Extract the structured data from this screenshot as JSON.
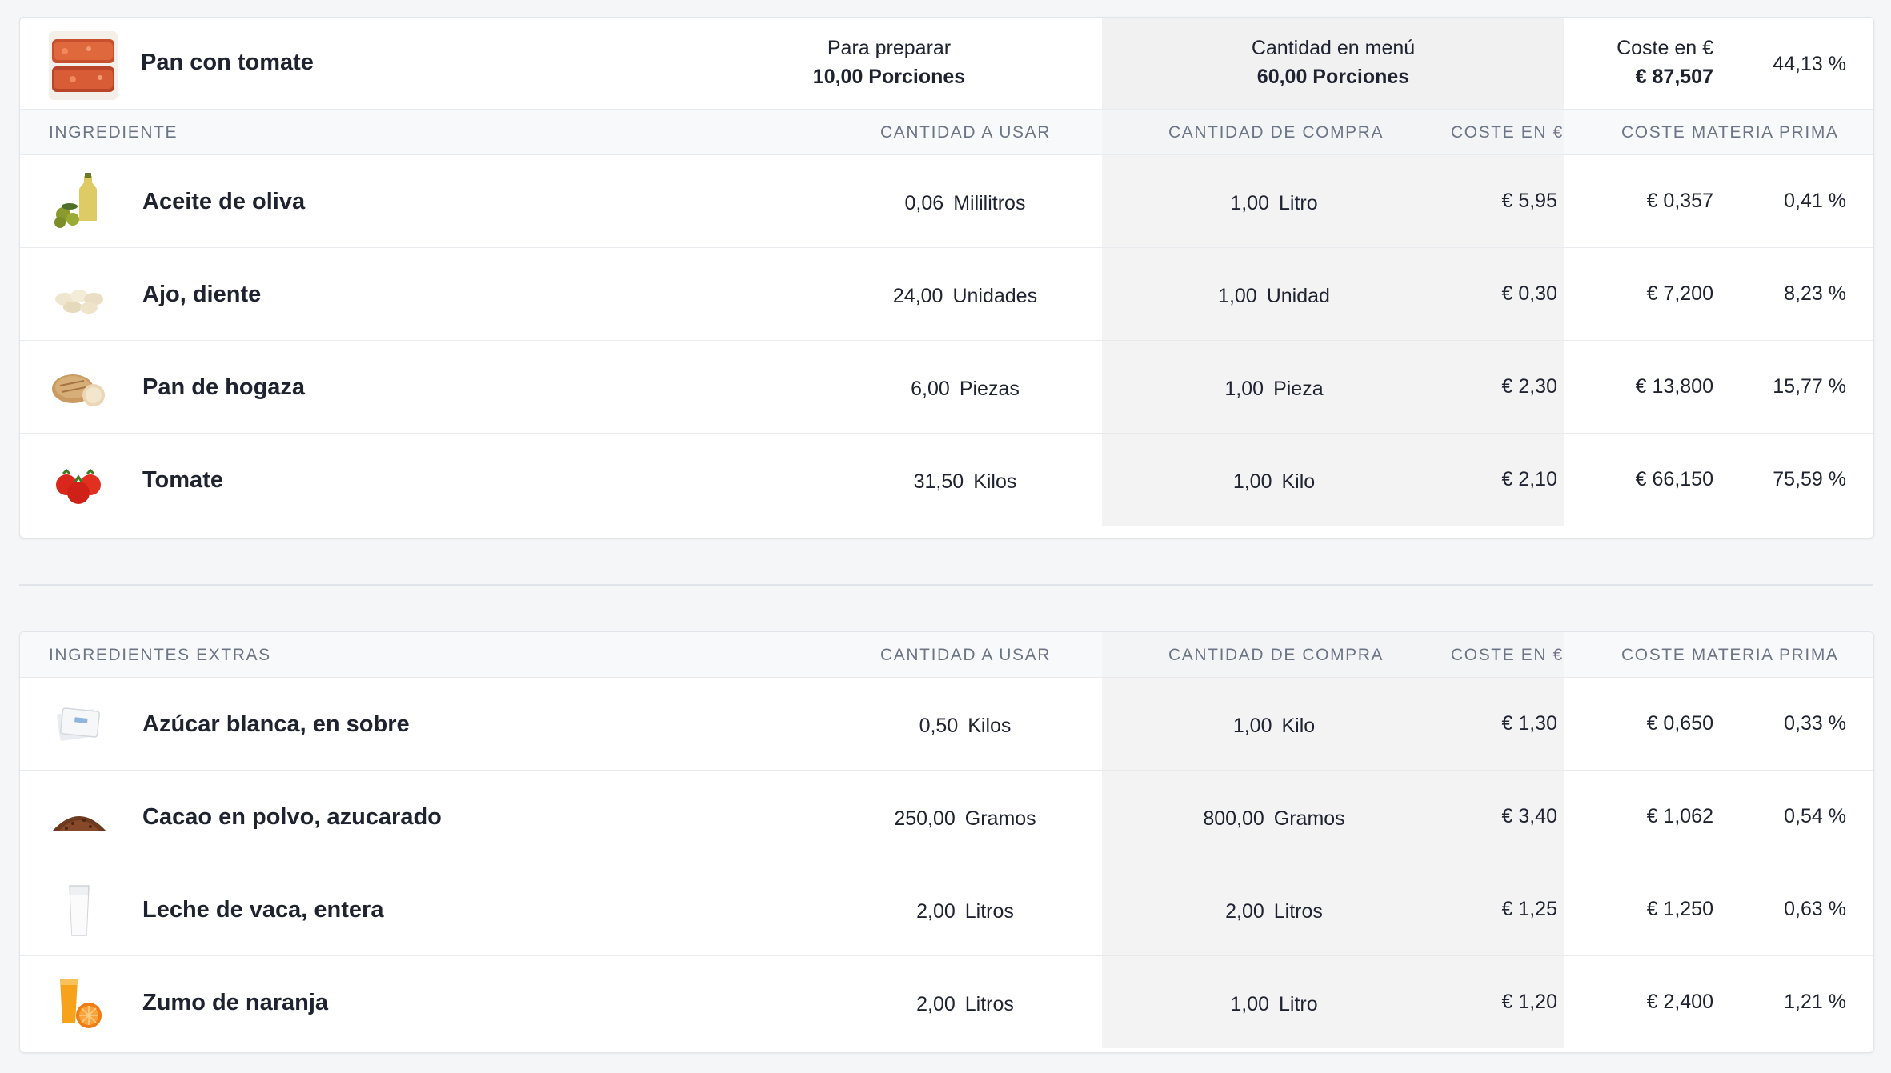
{
  "recipe": {
    "name": "Pan con tomate",
    "prepare_label": "Para preparar",
    "prepare_value": "10,00 Porciones",
    "menu_label": "Cantidad en menú",
    "menu_value": "60,00 Porciones",
    "cost_label": "Coste en €",
    "cost_value": "€ 87,507",
    "percent": "44,13 %",
    "thumb_icon": "bread-with-tomato-thumbnail"
  },
  "columns": {
    "qty_use": "CANTIDAD A USAR",
    "qty_buy": "CANTIDAD DE COMPRA",
    "cost": "COSTE EN €",
    "raw_cost": "COSTE MATERIA PRIMA"
  },
  "ingredients": {
    "title": "INGREDIENTE",
    "items": [
      {
        "name": "Aceite de oliva",
        "use_qty": "0,06",
        "use_unit": "Mililitros",
        "buy_qty": "1,00",
        "buy_unit": "Litro",
        "cost": "€ 5,95",
        "raw": "€ 0,357",
        "pct": "0,41 %",
        "icon": "olive-oil-thumbnail"
      },
      {
        "name": "Ajo, diente",
        "use_qty": "24,00",
        "use_unit": "Unidades",
        "buy_qty": "1,00",
        "buy_unit": "Unidad",
        "cost": "€ 0,30",
        "raw": "€ 7,200",
        "pct": "8,23 %",
        "icon": "garlic-thumbnail"
      },
      {
        "name": "Pan de hogaza",
        "use_qty": "6,00",
        "use_unit": "Piezas",
        "buy_qty": "1,00",
        "buy_unit": "Pieza",
        "cost": "€ 2,30",
        "raw": "€ 13,800",
        "pct": "15,77 %",
        "icon": "bread-loaf-thumbnail"
      },
      {
        "name": "Tomate",
        "use_qty": "31,50",
        "use_unit": "Kilos",
        "buy_qty": "1,00",
        "buy_unit": "Kilo",
        "cost": "€ 2,10",
        "raw": "€ 66,150",
        "pct": "75,59 %",
        "icon": "tomato-thumbnail"
      }
    ]
  },
  "extras": {
    "title": "INGREDIENTES EXTRAS",
    "items": [
      {
        "name": "Azúcar blanca, en sobre",
        "use_qty": "0,50",
        "use_unit": "Kilos",
        "buy_qty": "1,00",
        "buy_unit": "Kilo",
        "cost": "€ 1,30",
        "raw": "€ 0,650",
        "pct": "0,33 %",
        "icon": "sugar-sachet-thumbnail"
      },
      {
        "name": "Cacao en polvo, azucarado",
        "use_qty": "250,00",
        "use_unit": "Gramos",
        "buy_qty": "800,00",
        "buy_unit": "Gramos",
        "cost": "€ 3,40",
        "raw": "€ 1,062",
        "pct": "0,54 %",
        "icon": "cocoa-powder-thumbnail"
      },
      {
        "name": "Leche de vaca, entera",
        "use_qty": "2,00",
        "use_unit": "Litros",
        "buy_qty": "2,00",
        "buy_unit": "Litros",
        "cost": "€ 1,25",
        "raw": "€ 1,250",
        "pct": "0,63 %",
        "icon": "milk-glass-thumbnail"
      },
      {
        "name": "Zumo de naranja",
        "use_qty": "2,00",
        "use_unit": "Litros",
        "buy_qty": "1,00",
        "buy_unit": "Litro",
        "cost": "€ 1,20",
        "raw": "€ 2,400",
        "pct": "1,21 %",
        "icon": "orange-juice-thumbnail"
      }
    ]
  }
}
